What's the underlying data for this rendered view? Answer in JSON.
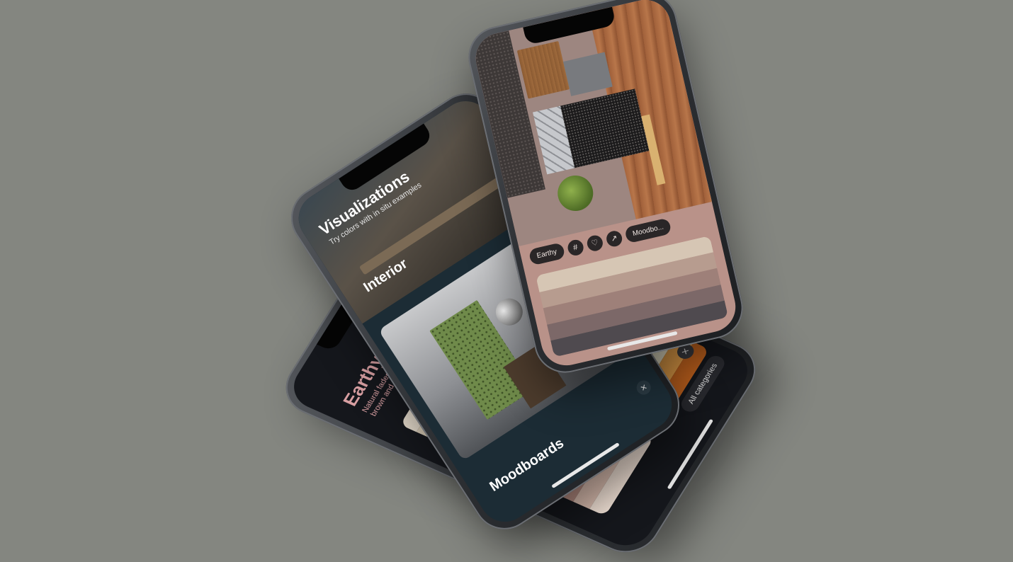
{
  "scene": {
    "background_color": "#848680"
  },
  "phone_palettes": {
    "title": "Earthy",
    "subtitle": "Natural faded color schemes with brown and green dominance",
    "all_categories_label": "All categories",
    "close_icon": "close-icon",
    "palettes": [
      {
        "colors": [
          "#d8cfc6",
          "#bfb3a7",
          "#a8988b",
          "#8e7d71"
        ]
      },
      {
        "colors": [
          "#7c6a4a",
          "#8e7a52",
          "#a48f62",
          "#5f6b4d"
        ]
      },
      {
        "colors": [
          "#e6dccd",
          "#d9cdb8",
          "#c9bba3",
          "#b5a68c"
        ]
      },
      {
        "colors": [
          "#c8c7b9",
          "#a9ac9a",
          "#8c917e",
          "#6f7566"
        ]
      },
      {
        "colors": [
          "#7e6a61",
          "#b98f84",
          "#e0c2b4",
          "#f4e4d8"
        ]
      },
      {
        "colors": [
          "#2f7a55",
          "#4f9a6c",
          "#7cc08f",
          "#b6e2bd"
        ]
      },
      {
        "colors": [
          "#4d5a2d",
          "#f0ead0",
          "#e6a04a",
          "#c0621e"
        ]
      }
    ]
  },
  "phone_visualizations": {
    "title": "Visualizations",
    "subtitle": "Try colors with in situ examples",
    "interior_label": "Interior",
    "moodboards_label": "Moodboards",
    "close_icon": "close-icon"
  },
  "phone_moodboard": {
    "chips": {
      "category_label": "Earthy",
      "hash_icon": "#",
      "heart_icon": "♡",
      "share_icon": "↗",
      "moodboards_label": "Moodbo..."
    },
    "palette": [
      "#d6c6b4",
      "#b79c8f",
      "#9e8079",
      "#7c6868",
      "#4f4a4f"
    ]
  }
}
